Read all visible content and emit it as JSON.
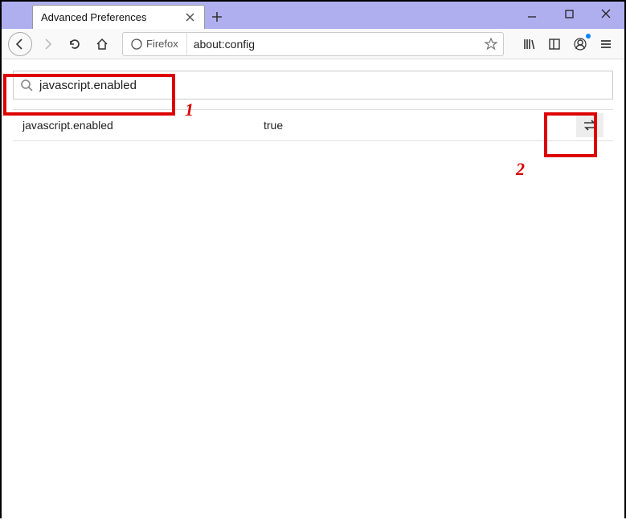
{
  "window": {
    "tab_title": "Advanced Preferences"
  },
  "toolbar": {
    "identity_label": "Firefox",
    "url": "about:config"
  },
  "config": {
    "search_value": "javascript.enabled",
    "result": {
      "name": "javascript.enabled",
      "value": "true"
    }
  },
  "annotations": {
    "one": "1",
    "two": "2"
  }
}
